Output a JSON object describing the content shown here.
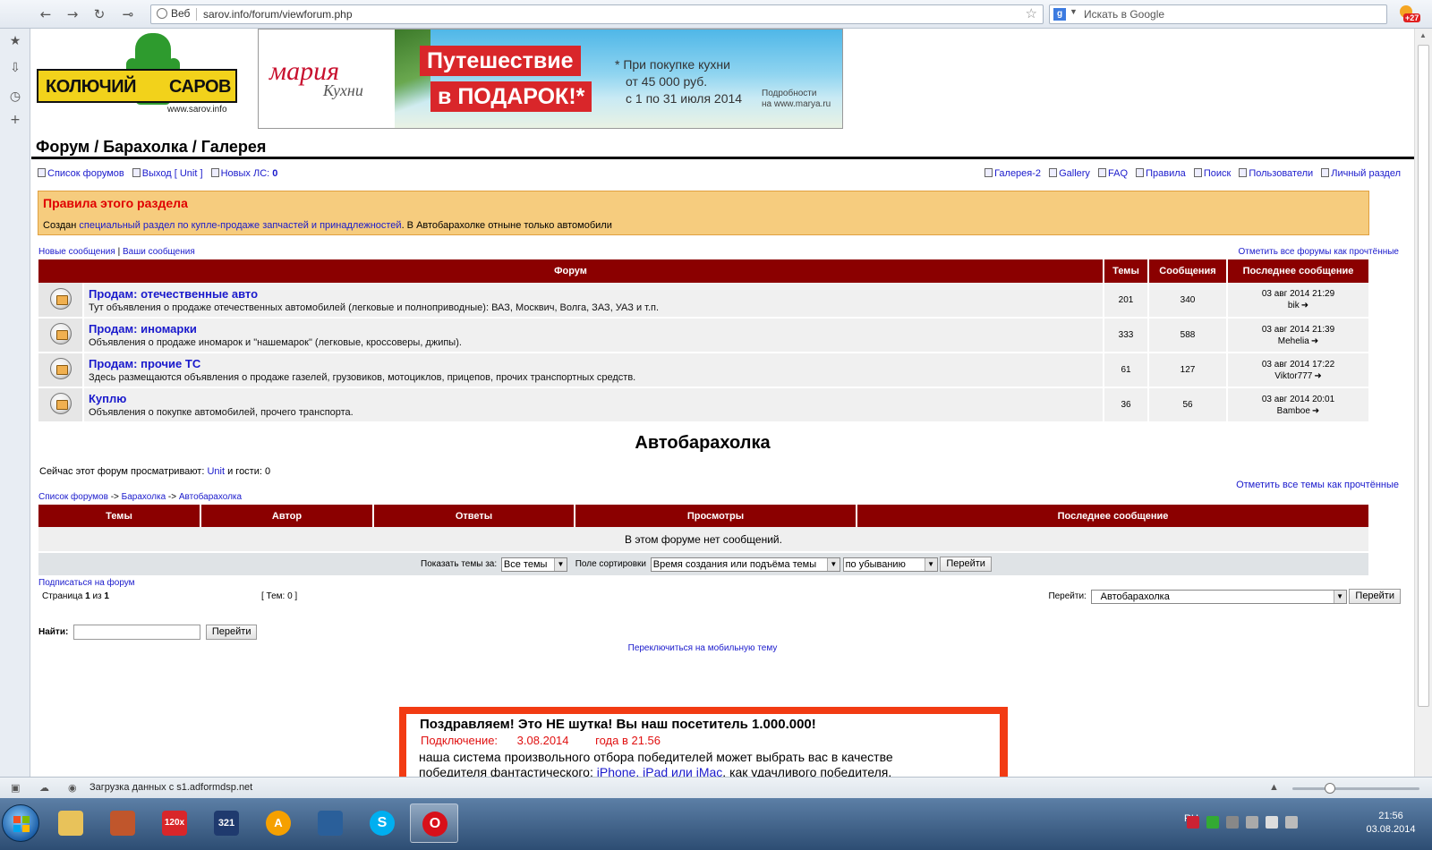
{
  "browser": {
    "search_mode": "Веб",
    "url": "sarov.info/forum/viewforum.php",
    "search_placeholder": "Искать в Google",
    "notifications": "+27",
    "status": "Загрузка данных с s1.adformdsp.net"
  },
  "logo": {
    "left": "КОЛЮЧИЙ",
    "right": "САРОВ",
    "site": "www.sarov.info"
  },
  "banner": {
    "brand": "мария",
    "brand_sub": "Кухни",
    "promo_line1": "Путешествие",
    "promo_line2": "в ПОДАРОК!*",
    "fine_line1": "* При покупке кухни",
    "fine_line2": "от 45 000 руб.",
    "fine_line3": "с 1 по 31 июля 2014",
    "fine_line4": "Подробности",
    "fine_line5": "на www.marya.ru"
  },
  "site_title": "Форум / Барахолка / Галерея",
  "menu_left": {
    "forum_list": "Список форумов",
    "logout": "Выход [ Unit ]",
    "new_pm": "Новых ЛС:",
    "new_pm_count": "0"
  },
  "menu_right": {
    "gallery2": "Галерея-2",
    "gallery": "Gallery",
    "faq": "FAQ",
    "rules": "Правила",
    "search": "Поиск",
    "users": "Пользователи",
    "personal": "Личный раздел"
  },
  "rules_box": {
    "title": "Правила этого раздела",
    "text_before": "Создан ",
    "link": "специальный раздел по купле-продаже запчастей и принадлежностей",
    "text_after": ". В Автобарахолке отныне только автомобили"
  },
  "links": {
    "new_posts": "Новые сообщения",
    "sep": "|",
    "your_posts": "Ваши сообщения",
    "mark_forums_read": "Отметить все форумы как прочтённые",
    "mark_topics_read": "Отметить все темы как прочтённые"
  },
  "forum_table": {
    "headers": [
      "Форум",
      "Темы",
      "Сообщения",
      "Последнее сообщение"
    ],
    "rows": [
      {
        "name": "Продам: отечественные авто",
        "desc": "Тут объявления о продаже отечественных автомобилей (легковые и полноприводные): ВАЗ, Москвич, Волга, ЗАЗ, УАЗ и т.п.",
        "topics": "201",
        "posts": "340",
        "last_date": "03 авг 2014 21:29",
        "last_user": "bik"
      },
      {
        "name": "Продам: иномарки",
        "desc": "Объявления о продаже иномарок и \"нашемарок\" (легковые, кроссоверы, джипы).",
        "topics": "333",
        "posts": "588",
        "last_date": "03 авг 2014 21:39",
        "last_user": "Mehelia"
      },
      {
        "name": "Продам: прочие ТС",
        "desc": "Здесь размещаются объявления о продаже газелей, грузовиков, мотоциклов, прицепов, прочих транспортных средств.",
        "topics": "61",
        "posts": "127",
        "last_date": "03 авг 2014 17:22",
        "last_user": "Viktor777"
      },
      {
        "name": "Куплю",
        "desc": "Объявления о покупке автомобилей, прочего транспорта.",
        "topics": "36",
        "posts": "56",
        "last_date": "03 авг 2014 20:01",
        "last_user": "Bamboe"
      }
    ]
  },
  "section_title": "Автобарахолка",
  "viewing": {
    "prefix": "Сейчас этот форум просматривают:",
    "user": "Unit",
    "suffix": "и гости: 0"
  },
  "breadcrumb": {
    "home": "Список форумов",
    "arrow": "->",
    "parent": "Барахолка",
    "current": "Автобарахолка"
  },
  "topic_table": {
    "headers": [
      "Темы",
      "Автор",
      "Ответы",
      "Просмотры",
      "Последнее сообщение"
    ],
    "empty": "В этом форуме нет сообщений."
  },
  "filters": {
    "show_label": "Показать темы за:",
    "show_value": "Все темы",
    "sort_label": "Поле сортировки",
    "sort_value": "Время создания или подъёма темы",
    "order_value": "по убыванию",
    "go": "Перейти"
  },
  "footer": {
    "subscribe": "Подписаться на форум",
    "page_label": "Страница",
    "page_current": "1",
    "page_of": "из",
    "page_total": "1",
    "topics_count": "[ Тем: 0 ]",
    "jump_label": "Перейти:",
    "jump_value": "Автобарахолка",
    "jump_btn": "Перейти",
    "find_label": "Найти:",
    "find_btn": "Перейти",
    "mobile": "Переключиться на мобильную тему"
  },
  "ad": {
    "line1": "Поздравляем! Это НЕ шутка! Вы наш посетитель 1.000.000!",
    "line2_a": "Подключение:",
    "line2_b": "3.08.2014",
    "line2_c": "года в 21.56",
    "line3": "наша система произвольного отбора победителей может выбрать вас в качестве",
    "line4_a": "победителя фантастического:",
    "line4_b": "iPhone, iPad или iMac",
    "line4_c": ". как удачливого победителя,"
  },
  "taskbar": {
    "lang": "RU",
    "time": "21:56",
    "date": "03.08.2014",
    "apps": [
      "explorer",
      "paint",
      "120x",
      "321-player",
      "aimp",
      "remote-desktop",
      "skype",
      "opera"
    ]
  },
  "colors": {
    "header_red": "#8b0000",
    "rules_bg": "#f6cc7e",
    "rules_title": "#e00000",
    "link": "#1a1acc"
  }
}
